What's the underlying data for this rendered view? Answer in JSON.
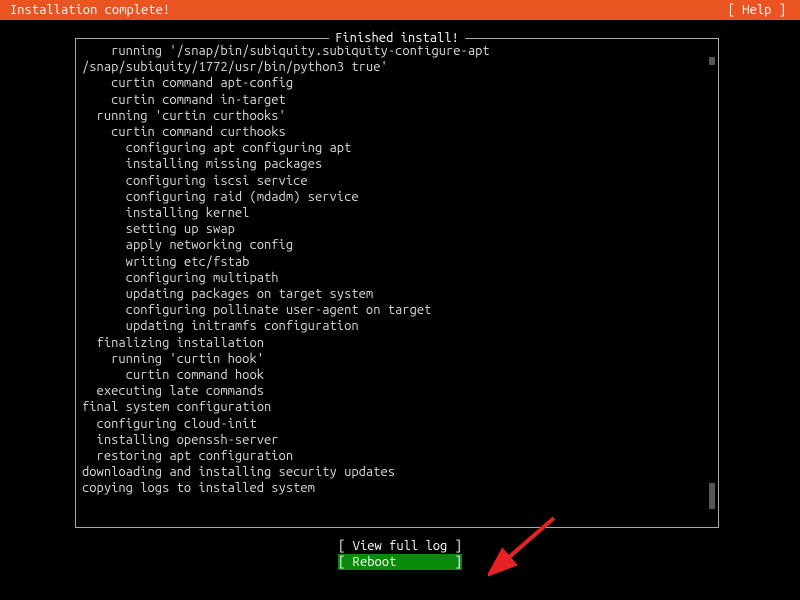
{
  "header": {
    "title": "Installation complete!",
    "help_label": "[ Help ]"
  },
  "panel": {
    "title": " Finished install! "
  },
  "log_lines": [
    "    running '/snap/bin/subiquity.subiquity-configure-apt",
    "/snap/subiquity/1772/usr/bin/python3 true'",
    "    curtin command apt-config",
    "    curtin command in-target",
    "  running 'curtin curthooks'",
    "    curtin command curthooks",
    "      configuring apt configuring apt",
    "      installing missing packages",
    "      configuring iscsi service",
    "      configuring raid (mdadm) service",
    "      installing kernel",
    "      setting up swap",
    "      apply networking config",
    "      writing etc/fstab",
    "      configuring multipath",
    "      updating packages on target system",
    "      configuring pollinate user-agent on target",
    "      updating initramfs configuration",
    "  finalizing installation",
    "    running 'curtin hook'",
    "      curtin command hook",
    "  executing late commands",
    "final system configuration",
    "  configuring cloud-init",
    "  installing openssh-server",
    "  restoring apt configuration",
    "downloading and installing security updates",
    "copying logs to installed system"
  ],
  "buttons": {
    "view_log": "[ View full log ]",
    "reboot": "[ Reboot        ]"
  }
}
